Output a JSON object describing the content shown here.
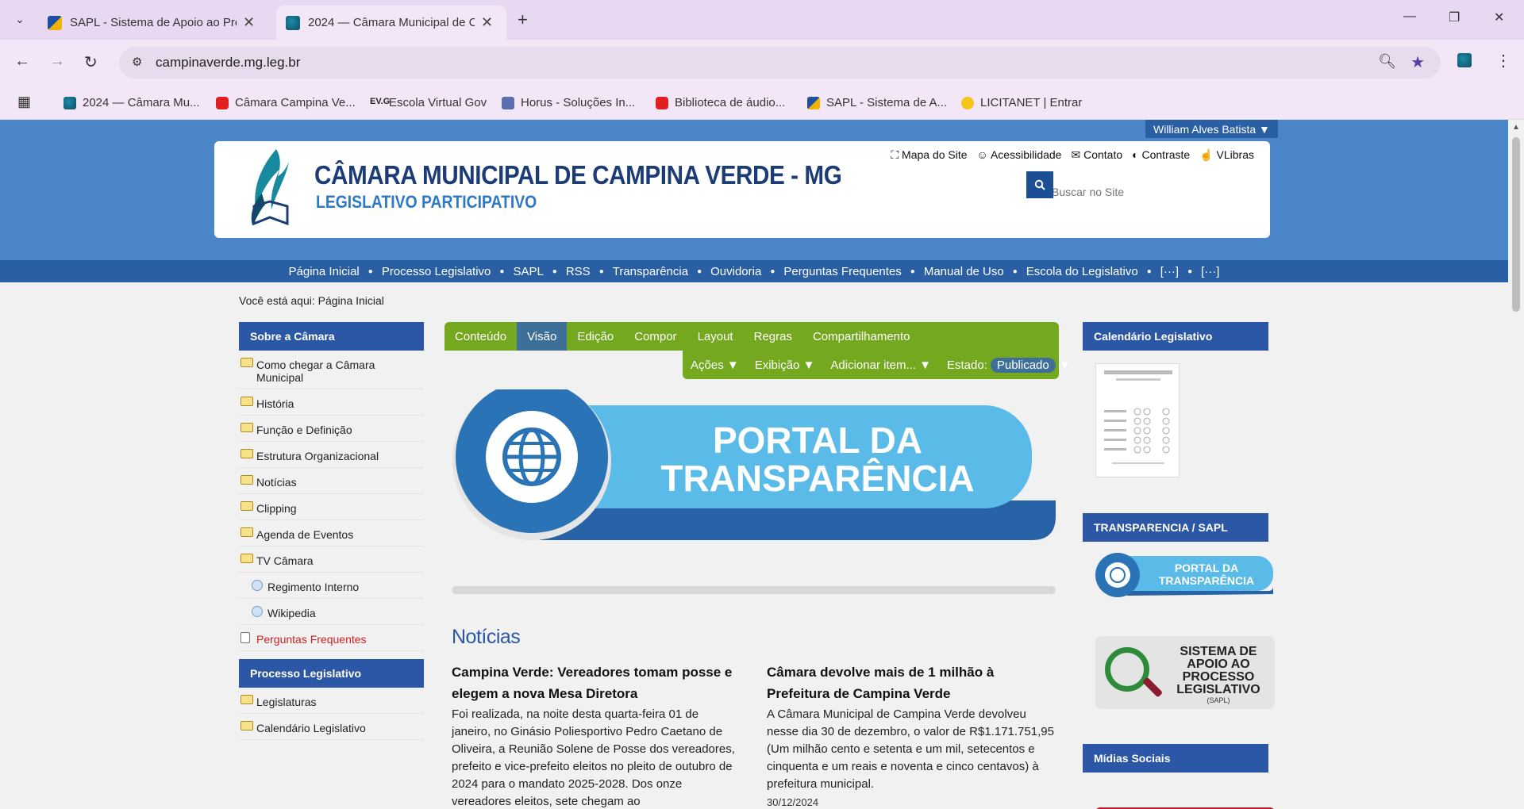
{
  "browser": {
    "tabs": [
      {
        "title": "SAPL - Sistema de Apoio ao Pro",
        "favicon": "sapl-icon"
      },
      {
        "title": "2024 — Câmara Municipal de C",
        "favicon": "camara-icon"
      }
    ],
    "url": "campinaverde.mg.leg.br",
    "bookmarks": [
      {
        "label": "2024 — Câmara Mu...",
        "icon": "camara-icon"
      },
      {
        "label": "Câmara Campina Ve...",
        "icon": "youtube-icon"
      },
      {
        "label": "Escola Virtual Gov",
        "icon": "evg-icon"
      },
      {
        "label": "Horus - Soluções In...",
        "icon": "horus-icon"
      },
      {
        "label": "Biblioteca de áudio...",
        "icon": "youtube-icon"
      },
      {
        "label": "SAPL - Sistema de A...",
        "icon": "sapl-icon"
      },
      {
        "label": "LICITANET | Entrar",
        "icon": "licitanet-icon"
      }
    ],
    "evg_text": "EV.G"
  },
  "site": {
    "user": "William Alves Batista ▼",
    "title": "CÂMARA MUNICIPAL DE CAMPINA VERDE - MG",
    "subtitle": "LEGISLATIVO PARTICIPATIVO",
    "top_links": [
      "Mapa do Site",
      "Acessibilidade",
      "Contato",
      "Contraste",
      "VLibras"
    ],
    "search_placeholder": "Buscar no Site",
    "nav": [
      "Página Inicial",
      "Processo Legislativo",
      "SAPL",
      "RSS",
      "Transparência",
      "Ouvidoria",
      "Perguntas Frequentes",
      "Manual de Uso",
      "Escola do Legislativo",
      "[···]",
      "[···]"
    ],
    "breadcrumb_label": "Você está aqui:",
    "breadcrumb_current": "Página Inicial"
  },
  "left": {
    "title1": "Sobre a Câmara",
    "items": [
      {
        "label": "Como chegar a Câmara Municipal",
        "type": "folder"
      },
      {
        "label": "História",
        "type": "folder"
      },
      {
        "label": "Função e Definição",
        "type": "folder"
      },
      {
        "label": "Estrutura Organizacional",
        "type": "folder"
      },
      {
        "label": "Notícias",
        "type": "folder"
      },
      {
        "label": "Clipping",
        "type": "folder"
      },
      {
        "label": "Agenda de Eventos",
        "type": "folder"
      },
      {
        "label": "TV Câmara",
        "type": "folder"
      },
      {
        "label": "Regimento Interno",
        "type": "link"
      },
      {
        "label": "Wikipedia",
        "type": "link"
      },
      {
        "label": "Perguntas Frequentes",
        "type": "doc"
      }
    ],
    "title2": "Processo Legislativo",
    "items2": [
      "Legislaturas",
      "Calendário Legislativo"
    ]
  },
  "cms": {
    "tabs": [
      "Conteúdo",
      "Visão",
      "Edição",
      "Compor",
      "Layout",
      "Regras",
      "Compartilhamento"
    ],
    "active_tab": "Visão",
    "actions": [
      "Ações ▼",
      "Exibição ▼",
      "Adicionar item... ▼",
      "Estado:"
    ],
    "state": "Publicado",
    "state_arrow": "▼"
  },
  "banner": {
    "line1": "PORTAL DA",
    "line2": "TRANSPARÊNCIA"
  },
  "news": {
    "heading": "Notícias",
    "items": [
      {
        "title": "Campina Verde: Vereadores tomam posse e elegem a nova Mesa Diretora",
        "body": "Foi realizada, na noite desta quarta-feira 01 de janeiro, no Ginásio Poliesportivo Pedro Caetano de Oliveira, a Reunião Solene de Posse dos vereadores, prefeito e vice-prefeito eleitos no pleito de outubro de 2024 para o mandato 2025-2028. Dos onze vereadores eleitos, sete chegam ao",
        "date": ""
      },
      {
        "title": "Câmara devolve mais de 1 milhão à Prefeitura de Campina Verde",
        "body": "A Câmara Municipal de Campina Verde devolveu nesse dia 30 de dezembro, o valor de R$1.171.751,95 (Um milhão cento e setenta e um mil, setecentos e cinquenta e um reais e noventa e cinco centavos) à prefeitura municipal.",
        "date": "30/12/2024"
      }
    ]
  },
  "right": {
    "title1": "Calendário Legislativo",
    "title2": "TRANSPARENCIA / SAPL",
    "portal_line1": "PORTAL DA",
    "portal_line2": "TRANSPARÊNCIA",
    "sapl_text": "SISTEMA DE APOIO AO PROCESSO LEGISLATIVO",
    "sapl_small": "(SAPL)",
    "title3": "Mídias Sociais"
  }
}
